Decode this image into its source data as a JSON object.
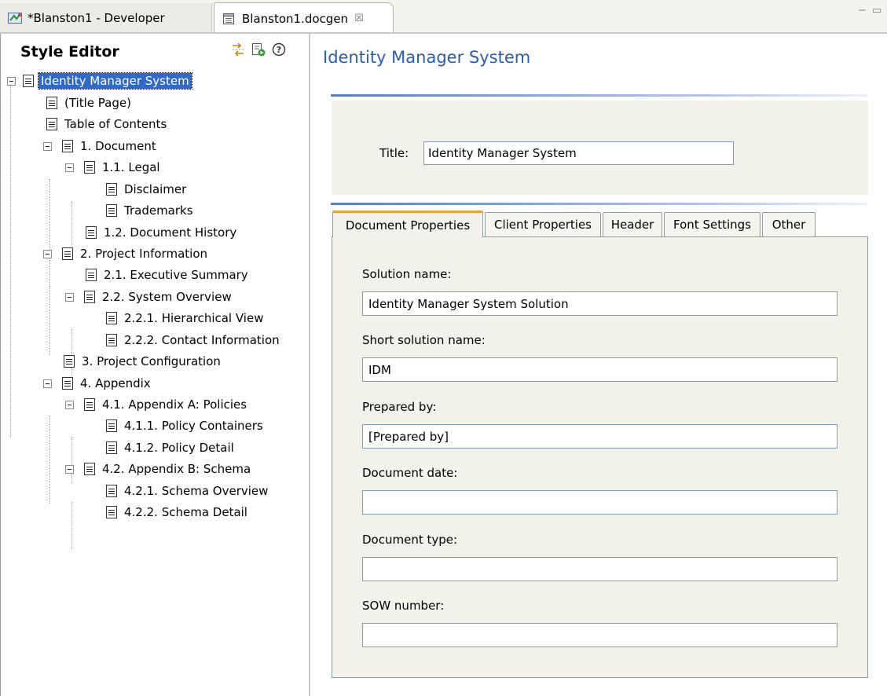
{
  "tabs": {
    "inactive_label": "*Blanston1 - Developer",
    "active_label": "Blanston1.docgen",
    "close_glyph": "☒"
  },
  "window_controls": {
    "minimize": "−",
    "maximize": "▭"
  },
  "style_editor": {
    "title": "Style Editor",
    "tools": [
      "expand-collapse-icon",
      "run-report-icon",
      "help-icon"
    ],
    "help_glyph": "?",
    "tree": [
      {
        "label": "Identity Manager System"
      },
      {
        "label": "(Title Page)"
      },
      {
        "label": "Table of Contents"
      },
      {
        "label": "1. Document"
      },
      {
        "label": "1.1. Legal"
      },
      {
        "label": "Disclaimer"
      },
      {
        "label": "Trademarks"
      },
      {
        "label": "1.2. Document History"
      },
      {
        "label": "2. Project  Information"
      },
      {
        "label": "2.1. Executive Summary"
      },
      {
        "label": "2.2. System Overview"
      },
      {
        "label": "2.2.1. Hierarchical View"
      },
      {
        "label": "2.2.2. Contact Information"
      },
      {
        "label": "3. Project Configuration"
      },
      {
        "label": "4. Appendix"
      },
      {
        "label": "4.1. Appendix A: Policies"
      },
      {
        "label": "4.1.1. Policy Containers"
      },
      {
        "label": "4.1.2. Policy Detail"
      },
      {
        "label": "4.2. Appendix B: Schema"
      },
      {
        "label": "4.2.1. Schema Overview"
      },
      {
        "label": "4.2.2. Schema Detail"
      }
    ]
  },
  "main": {
    "heading": "Identity Manager System",
    "title_label": "Title:",
    "title_value": "Identity Manager System",
    "property_tabs": [
      "Document Properties",
      "Client Properties",
      "Header",
      "Font Settings",
      "Other"
    ],
    "active_tab": "Document Properties",
    "fields": {
      "solution_name": {
        "label": "Solution name:",
        "value": "Identity Manager System Solution"
      },
      "short_solution_name": {
        "label": "Short solution name:",
        "value": "IDM"
      },
      "prepared_by": {
        "label": "Prepared by:",
        "value": "[Prepared by]"
      },
      "document_date": {
        "label": "Document date:",
        "value": ""
      },
      "document_type": {
        "label": "Document type:",
        "value": ""
      },
      "sow_number": {
        "label": "SOW number:",
        "value": ""
      }
    }
  },
  "colors": {
    "heading_blue": "#2a5ea8",
    "selection_blue": "#316ac5",
    "active_tab_accent": "#e8a33a",
    "panel_bg": "#f2f1ea"
  }
}
